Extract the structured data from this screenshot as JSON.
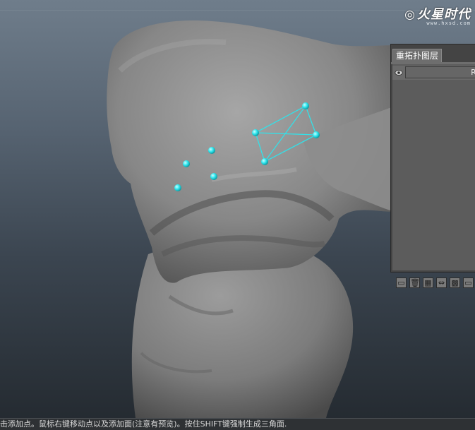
{
  "watermark": {
    "logo": "火星时代",
    "url": "www.hxsd.com"
  },
  "panel": {
    "tab_title": "重拓扑图层",
    "layer_name": "Re",
    "toolbar_icons": [
      "new-layer-icon",
      "trash-icon",
      "grid-icon",
      "arrows-icon",
      "mesh-icon",
      "more-icon"
    ]
  },
  "status": {
    "message": "击添加点。鼠标右键移动点以及添加面(注意有预览)。按住SHIFT键强制生成三角面."
  },
  "colors": {
    "vertex": "#2ee6ee",
    "wire": "#33e0e8",
    "model": "#8a8a8a",
    "panel_bg": "#5c5c5c"
  }
}
